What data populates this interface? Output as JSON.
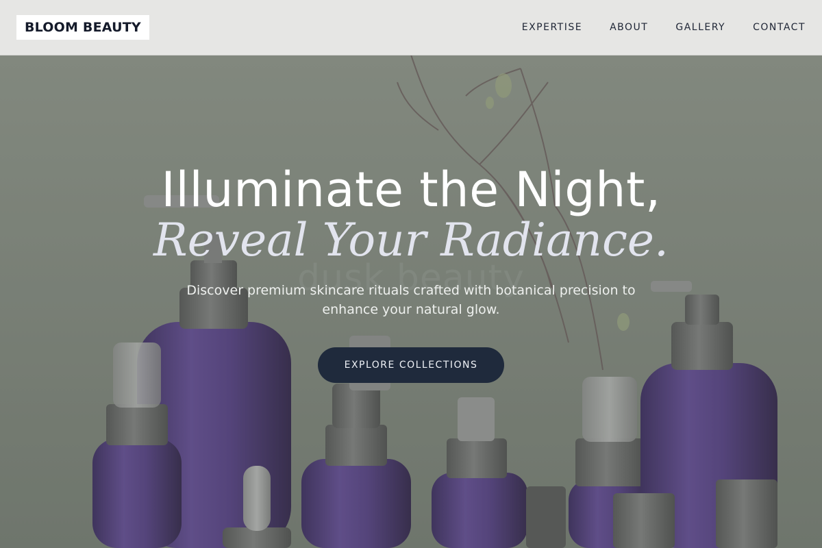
{
  "nav": {
    "logo": "BLOOM BEAUTY",
    "links": [
      "EXPERTISE",
      "ABOUT",
      "GALLERY",
      "CONTACT"
    ]
  },
  "hero": {
    "headline_line1": "Illuminate the Night,",
    "headline_line2": "Reveal Your Radiance.",
    "watermark": "dusk beauty",
    "description": "Discover premium skincare rituals crafted with botanical precision to enhance your natural glow.",
    "cta_label": "EXPLORE COLLECTIONS"
  },
  "colors": {
    "nav_background": "#e6e6e4",
    "hero_background": "#7d8479",
    "bottle_purple": "#5a3f8c",
    "cap_gray": "#6f6f6f",
    "cta_background": "#1f2a3c",
    "cta_text": "#eef1f6"
  }
}
